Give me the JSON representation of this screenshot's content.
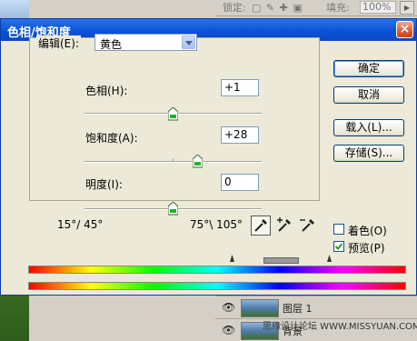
{
  "photoshop": {
    "lock_label": "锁定:",
    "fill_label": "填充:",
    "fill_value": "100%",
    "layers": [
      "图层 1",
      "背景"
    ],
    "watermark": "思缘设计论坛 WWW.MISSYUAN.COM"
  },
  "dialog": {
    "title": "色相/饱和度",
    "close_glyph": "×",
    "edit_label": "编辑(E):",
    "edit_value": "黄色",
    "sliders": [
      {
        "label": "色相(H):",
        "value": "+1",
        "level": 0.5
      },
      {
        "label": "饱和度(A):",
        "value": "+28",
        "level": 0.64
      },
      {
        "label": "明度(I):",
        "value": "0",
        "level": 0.5
      }
    ],
    "buttons": {
      "ok": "确定",
      "cancel": "取消",
      "load": "载入(L)...",
      "save": "存储(S)..."
    },
    "colorize_label": "着色(O)",
    "colorize_checked": false,
    "preview_label": "预览(P)",
    "preview_checked": true,
    "angle_left": "15°/ 45°",
    "angle_right": "75°\\ 105°",
    "range_colors": [
      "#ff0000",
      "#ffff00",
      "#00ff00",
      "#00ffff",
      "#0000ff",
      "#ff00ff"
    ],
    "accent_color": "#0a53d6"
  }
}
